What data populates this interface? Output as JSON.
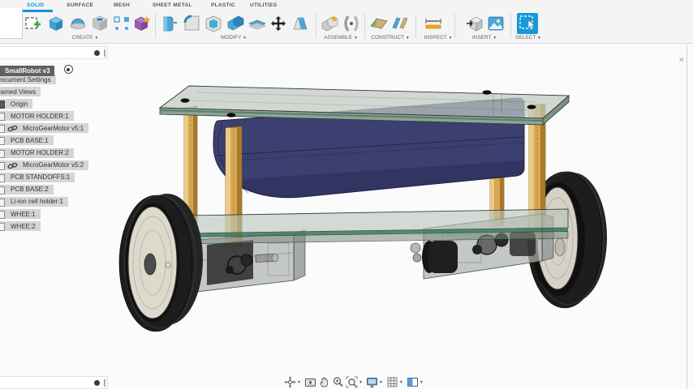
{
  "ribbon": {
    "accent": "#0696d7",
    "tabs": [
      {
        "label": "SOLID",
        "active": true
      },
      {
        "label": "SURFACE",
        "active": false
      },
      {
        "label": "MESH",
        "active": false
      },
      {
        "label": "SHEET METAL",
        "active": false
      },
      {
        "label": "PLASTIC",
        "active": false
      },
      {
        "label": "UTILITIES",
        "active": false
      }
    ],
    "groups": {
      "create": "CREATE",
      "modify": "MODIFY",
      "assemble": "ASSEMBLE",
      "construct": "CONSTRUCT",
      "inspect": "INSPECT",
      "insert": "INSERT",
      "select": "SELECT"
    }
  },
  "browser": {
    "root": {
      "label": "SmallRobot v3"
    },
    "items": [
      {
        "label": "Document Settings",
        "icon": "none",
        "clip": true
      },
      {
        "label": "Named Views",
        "icon": "none",
        "clip": true
      },
      {
        "label": "Origin",
        "icon": "origin",
        "clip": false
      },
      {
        "label": "MOTOR HOLDER:1",
        "icon": "component",
        "clip": false
      },
      {
        "label": "MicroGearMotor v5:1",
        "icon": "link",
        "clip": false
      },
      {
        "label": "PCB BASE:1",
        "icon": "component",
        "clip": false
      },
      {
        "label": "MOTOR HOLDER:2",
        "icon": "component",
        "clip": false
      },
      {
        "label": "MicroGearMotor v5:2",
        "icon": "link",
        "clip": false
      },
      {
        "label": "PCB STANDOFFS:1",
        "icon": "component",
        "clip": false
      },
      {
        "label": "PCB BASE:2",
        "icon": "component",
        "clip": false
      },
      {
        "label": "Li-ion cell holder:1",
        "icon": "component",
        "clip": false
      },
      {
        "label": "WHEE:1",
        "icon": "component",
        "clip": false
      },
      {
        "label": "WHEE:2",
        "icon": "component",
        "clip": false
      }
    ]
  },
  "viewport": {
    "marker": "✕"
  },
  "navbar": {
    "tools": [
      "orbit",
      "look-at",
      "pan",
      "zoom",
      "fit",
      "display-settings",
      "grid-snap",
      "viewports"
    ]
  },
  "model": {
    "name": "SmallRobot v3",
    "colors": {
      "battery": "#3c4070",
      "batteryEdge": "#20243f",
      "standoff": "#d8a752",
      "standoffHi": "#eccb87",
      "standoffSh": "#a8792c",
      "glassTop": "rgba(193,202,193,0.72)",
      "glassBottom": "rgba(185,195,187,0.60)",
      "glassEdge": "#8fa296",
      "tealEdge": "#3f7b63",
      "tire": "#1d1d1d",
      "hubDisc": "#ddd9cc",
      "motorDark": "#2e2e2e",
      "holder": "rgba(175,180,175,0.72)"
    }
  }
}
